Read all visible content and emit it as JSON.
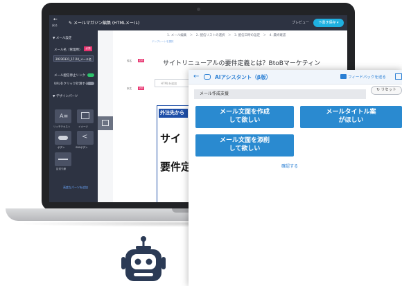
{
  "app": {
    "back_label": "戻る",
    "title": "メールマガジン編集 (HTMLメール)",
    "preview": "プレビュー",
    "save_button": "下書き保存"
  },
  "sidebar": {
    "mail_settings": "▼ メール設定",
    "mail_name_label": "メール名（管理用）",
    "required_badge": "必須",
    "mail_name_value": "20230331_17:24_メール名",
    "opinion_link": "メール配信停止リンク",
    "url_click": "URLをクリック計測する",
    "design_parts": "▼ デザインパーツ",
    "parts": [
      "リッチテキスト",
      "イメージ",
      "ボタン",
      "SNSボタン",
      "区切り線"
    ],
    "add_more": "高度なパーツを追加"
  },
  "content": {
    "steps": "1. メール編集　＞　2. 配信リストの選択　＞　3. 配信日時の設定　＞　4. 最終確認",
    "template_link": "テンプレートを選択",
    "subject_label": "件名",
    "required": "必須",
    "subject_value": "サイトリニューアルの要件定義とは？BtoBマーケティン",
    "body_label": "本文",
    "html_field": "HTMLを追加",
    "preview_head": "外注先から",
    "preview_big1": "サイ",
    "preview_big2": "要件定"
  },
  "ai_panel": {
    "back_icon": "←",
    "title": "AIアシスタント（β版）",
    "feedback": "フィードバックを送る",
    "reset": "リセット",
    "section": "メール作成支援",
    "btn_create": "メール文面を作成して欲しい",
    "btn_title": "メールタイトル案がほしい",
    "btn_trim": "メール文面を添削して欲しい",
    "confirm": "確認する"
  },
  "colors": {
    "accent_blue": "#2a8ad0",
    "dark_sidebar": "#2d3342",
    "required_pink": "#e8336f",
    "toggle_green": "#2dc26b"
  }
}
